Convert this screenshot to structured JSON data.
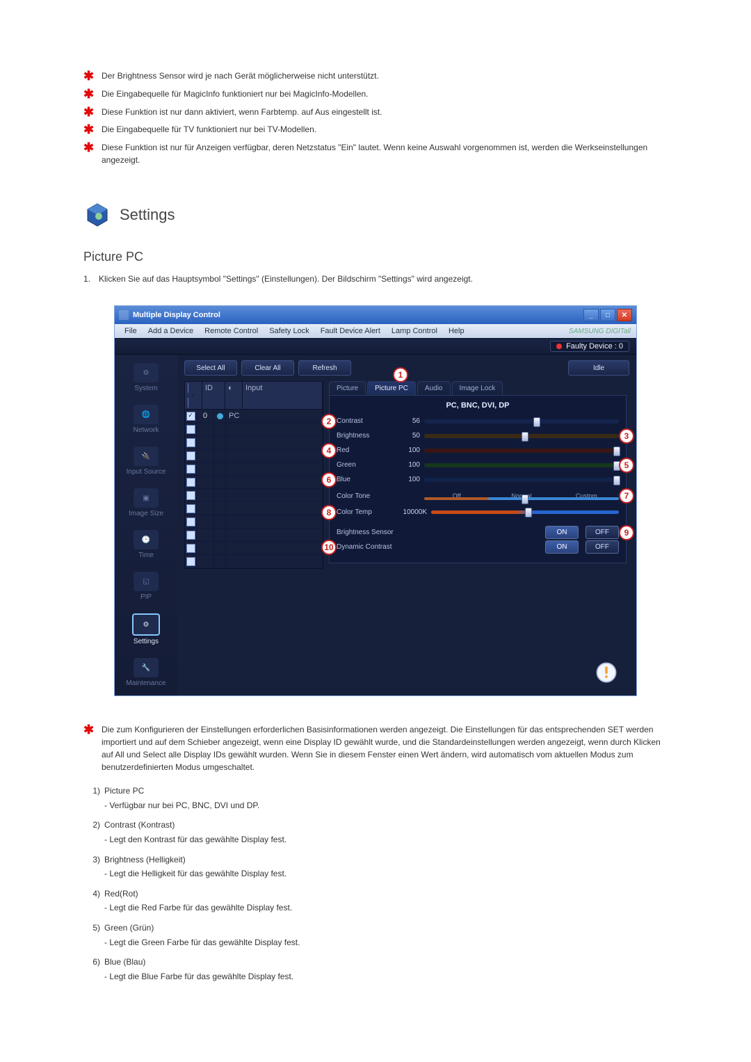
{
  "bullets": [
    "Der Brightness Sensor wird je nach Gerät möglicherweise nicht unterstützt.",
    "Die Eingabequelle für MagicInfo funktioniert nur bei MagicInfo-Modellen.",
    "Diese Funktion ist nur dann aktiviert, wenn Farbtemp. auf Aus eingestellt ist.",
    "Die Eingabequelle für TV funktioniert nur bei TV-Modellen.",
    "Diese Funktion ist nur für Anzeigen verfügbar, deren Netzstatus \"Ein\" lautet. Wenn keine Auswahl vorgenommen ist, werden die Werkseinstellungen angezeigt."
  ],
  "heading": "Settings",
  "subheading": "Picture PC",
  "intro_num": "1.",
  "intro_text": "Klicken Sie auf das Hauptsymbol \"Settings\" (Einstellungen). Der Bildschirm \"Settings\" wird angezeigt.",
  "app": {
    "title": "Multiple Display Control",
    "menus": [
      "File",
      "Add a Device",
      "Remote Control",
      "Safety Lock",
      "Fault Device Alert",
      "Lamp Control",
      "Help"
    ],
    "brand": "SAMSUNG DIGITall",
    "faulty": "Faulty Device : 0",
    "buttons": {
      "select_all": "Select All",
      "clear_all": "Clear All",
      "refresh": "Refresh",
      "idle": "Idle"
    },
    "sidebar": [
      {
        "label": "System"
      },
      {
        "label": "Network"
      },
      {
        "label": "Input Source"
      },
      {
        "label": "Image Size"
      },
      {
        "label": "Time"
      },
      {
        "label": "PIP"
      },
      {
        "label": "Settings"
      },
      {
        "label": "Maintenance"
      }
    ],
    "table": {
      "headers": {
        "id": "ID",
        "input": "Input"
      },
      "row1": {
        "id": "0",
        "input": "PC"
      }
    },
    "tabs": [
      "Picture",
      "Picture PC",
      "Audio",
      "Image Lock"
    ],
    "panel_title": "PC, BNC, DVI, DP",
    "rows": {
      "contrast": {
        "label": "Contrast",
        "value": "56"
      },
      "brightness": {
        "label": "Brightness",
        "value": "50"
      },
      "red": {
        "label": "Red",
        "value": "100"
      },
      "green": {
        "label": "Green",
        "value": "100"
      },
      "blue": {
        "label": "Blue",
        "value": "100"
      },
      "color_tone": {
        "label": "Color Tone",
        "opts": [
          "Off",
          "Normal",
          "Custom"
        ]
      },
      "color_temp": {
        "label": "Color Temp",
        "value": "10000K"
      },
      "br_sensor": {
        "label": "Brightness Sensor"
      },
      "dyn_contrast": {
        "label": "Dynamic Contrast"
      },
      "on": "ON",
      "off": "OFF"
    },
    "callouts": [
      "1",
      "2",
      "3",
      "4",
      "5",
      "6",
      "7",
      "8",
      "9",
      "10"
    ]
  },
  "info_text": "Die zum Konfigurieren der Einstellungen erforderlichen Basisinformationen werden angezeigt. Die Einstellungen für das entsprechenden SET werden importiert und auf dem Schieber angezeigt, wenn eine Display ID gewählt wurde, und die Standardeinstellungen werden angezeigt, wenn durch Klicken auf All und Select alle Display IDs gewählt wurden. Wenn Sie in diesem Fenster einen Wert ändern, wird automatisch vom aktuellen Modus zum benutzerdefinierten Modus umgeschaltet.",
  "ol": [
    {
      "n": "1)",
      "t": "Picture PC",
      "s": "- Verfügbar nur bei PC, BNC, DVI und DP."
    },
    {
      "n": "2)",
      "t": "Contrast (Kontrast)",
      "s": "- Legt den Kontrast für das gewählte Display fest."
    },
    {
      "n": "3)",
      "t": "Brightness (Helligkeit)",
      "s": "- Legt die Helligkeit für das gewählte Display fest."
    },
    {
      "n": "4)",
      "t": "Red(Rot)",
      "s": "- Legt die Red Farbe für das gewählte Display fest."
    },
    {
      "n": "5)",
      "t": "Green (Grün)",
      "s": "- Legt die Green Farbe für das gewählte Display fest."
    },
    {
      "n": "6)",
      "t": "Blue (Blau)",
      "s": "- Legt die Blue Farbe für das gewählte Display fest."
    }
  ]
}
